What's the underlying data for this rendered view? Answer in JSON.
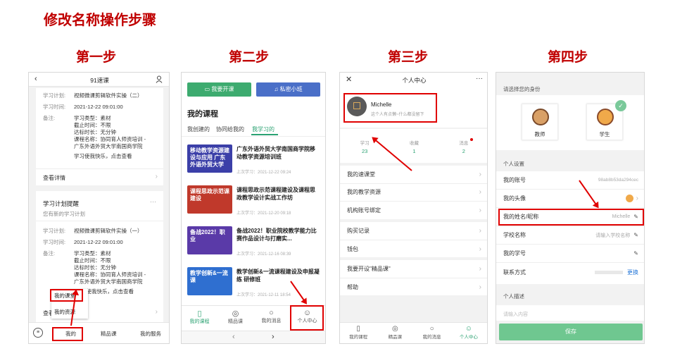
{
  "page_title": "修改名称操作步骤",
  "steps": [
    "第一步",
    "第二步",
    "第三步",
    "第四步"
  ],
  "phone1": {
    "header_title": "91速课",
    "card1": {
      "plan_label": "学习计划:",
      "plan_value": "视频微课剪辑软件实操（二）",
      "time_label": "学习时间:",
      "time_value": "2021-12-22 09:01:00",
      "note_label": "备注:",
      "note_lines": [
        "学习类型：素材",
        "截止时间：不限",
        "达标时长：无分钟",
        "课程名称：协同育人师资培训 -",
        "广东外语外贸大学南国商学院"
      ],
      "note_tail": "学习使我快乐，点击查看",
      "detail": "查看详情"
    },
    "card2": {
      "heading": "学习计划提醒",
      "sub": "您有新的学习计划",
      "more": "···",
      "plan_label": "学习计划:",
      "plan_value": "视频微课剪辑软件实操（一）",
      "time_label": "学习时间:",
      "time_value": "2021-12-22 09:01:00",
      "note_label": "备注:",
      "note_lines": [
        "学习类型：素材",
        "截止时间：不限",
        "达标时长：无分钟",
        "课程名称：协同育人师资培训 -",
        "广东外语外贸大学南国商学院"
      ],
      "note_tail": "习使我快乐，点击查看",
      "detail_partial": "查看"
    },
    "popup": {
      "item1": "我的课堂",
      "item2": "我的资源"
    },
    "tabs": {
      "t1": "我的",
      "t2": "精品课",
      "t3": "我的服务"
    }
  },
  "phone2": {
    "btn1": "我要开课",
    "btn2": "私密小班",
    "section": "我的课程",
    "tabs": [
      "我创建的",
      "协同给我的",
      "我学习的"
    ],
    "courses": [
      {
        "thumb": "移动教学资源建设与应用 广东外语外贸大学",
        "title": "广东外语外贸大学南国商学院移动教学资源培训班",
        "date": "上次学习：2021-12-22 09:24",
        "color": "#3b3fa8"
      },
      {
        "thumb": "课程思政示范课建设",
        "title": "课程思政示范课程建设及课程思政教学设计实战工作坊",
        "date": "上次学习：2021-12-20 09:18",
        "color": "#c0392b"
      },
      {
        "thumb": "备战2022！职业",
        "title": "备战2022！职业院校教学能力比赛作品设计与打磨实...",
        "date": "上次学习：2021-12-16 08:39",
        "color": "#5a3aa8"
      },
      {
        "thumb": "教学创新&一流课",
        "title": "教学创新&一流课程建设及申报凝练 研修班",
        "date": "上次学习：2021-12-11 18:54",
        "color": "#2f6fd0"
      }
    ],
    "tabbar": [
      "我的课程",
      "精品课",
      "我的消息",
      "个人中心"
    ]
  },
  "phone3": {
    "header_title": "个人中心",
    "name": "Michelle",
    "signature": "这个人有点懒~什么都没留下",
    "stats": [
      {
        "label": "学习",
        "value": "23"
      },
      {
        "label": "收藏",
        "value": "1"
      },
      {
        "label": "消息",
        "value": "2"
      }
    ],
    "menu": [
      "我的速课堂",
      "我的教学资源",
      "机构账号绑定",
      "购买记录",
      "钱包",
      "我要开设\"精品课\"",
      "帮助"
    ],
    "tabbar": [
      "我的课程",
      "精品课",
      "我的消息",
      "个人中心"
    ]
  },
  "phone4": {
    "identity_title": "请选择您的身份",
    "teacher": "教师",
    "student": "学生",
    "settings_title": "个人设置",
    "account_label": "我的账号",
    "account_value": "98ab8b53da294cec",
    "avatar_label": "我的头像",
    "name_label": "我的姓名/昵称",
    "name_value": "Michelle",
    "school_label": "学校名称",
    "school_placeholder": "请输入学校名称",
    "stuid_label": "我的学号",
    "contact_label": "联系方式",
    "contact_action": "更换",
    "desc_title": "个人描述",
    "desc_placeholder": "请输入内容",
    "save": "保存"
  },
  "colors": {
    "accent_red": "#c00000",
    "green": "#2ba272",
    "blue": "#4a6fc8",
    "box_red": "#e00000"
  }
}
